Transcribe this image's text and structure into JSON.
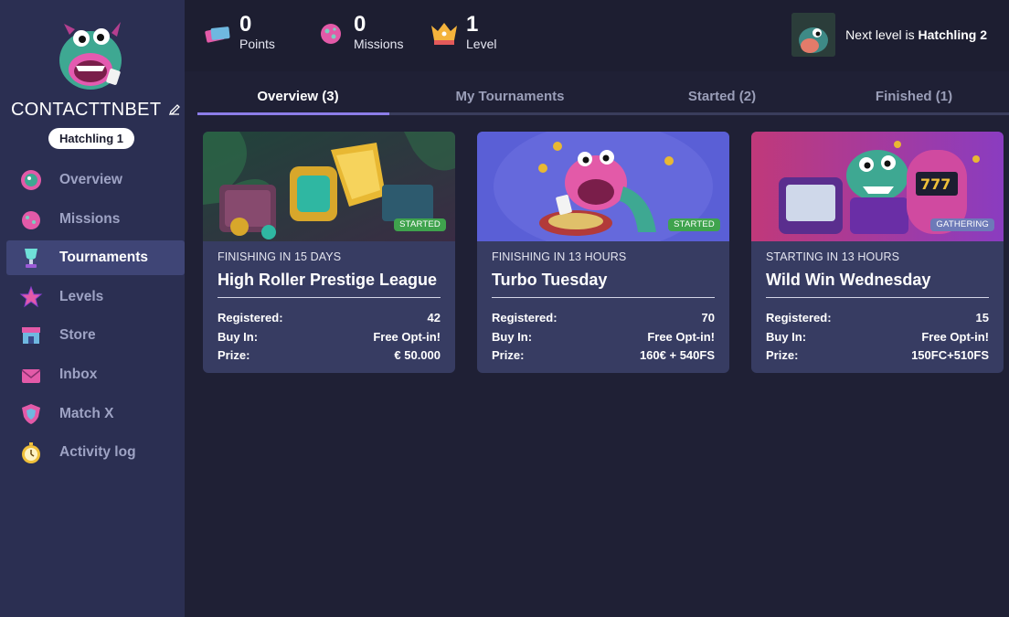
{
  "sidebar": {
    "username": "CONTACTTNBET",
    "level_badge": "Hatchling 1",
    "items": [
      {
        "label": "Overview",
        "icon": "dino-badge-icon",
        "active": false
      },
      {
        "label": "Missions",
        "icon": "egg-icon",
        "active": false
      },
      {
        "label": "Tournaments",
        "icon": "trophy-icon",
        "active": true
      },
      {
        "label": "Levels",
        "icon": "star-icon",
        "active": false
      },
      {
        "label": "Store",
        "icon": "store-icon",
        "active": false
      },
      {
        "label": "Inbox",
        "icon": "envelope-icon",
        "active": false
      },
      {
        "label": "Match X",
        "icon": "shield-icon",
        "active": false
      },
      {
        "label": "Activity log",
        "icon": "stopwatch-icon",
        "active": false
      }
    ]
  },
  "stats": {
    "points": {
      "value": "0",
      "label": "Points",
      "icon": "tickets-icon"
    },
    "missions": {
      "value": "0",
      "label": "Missions",
      "icon": "egg-icon"
    },
    "level": {
      "value": "1",
      "label": "Level",
      "icon": "crown-icon"
    }
  },
  "next_level": {
    "prefix": "Next level is",
    "name": "Hatchling 2"
  },
  "tabs": [
    {
      "label": "Overview (3)",
      "active": true
    },
    {
      "label": "My Tournaments",
      "active": false
    },
    {
      "label": "Started (2)",
      "active": false
    },
    {
      "label": "Finished (1)",
      "active": false
    }
  ],
  "cards": [
    {
      "status": "STARTED",
      "status_color": "#3fa34d",
      "when": "FINISHING IN 15 DAYS",
      "title": "High Roller Prestige League",
      "registered_label": "Registered:",
      "registered": "42",
      "buyin_label": "Buy In:",
      "buyin": "Free Opt-in!",
      "prize_label": "Prize:",
      "prize": "€ 50.000"
    },
    {
      "status": "STARTED",
      "status_color": "#3fa34d",
      "when": "FINISHING IN 13 HOURS",
      "title": "Turbo Tuesday",
      "registered_label": "Registered:",
      "registered": "70",
      "buyin_label": "Buy In:",
      "buyin": "Free Opt-in!",
      "prize_label": "Prize:",
      "prize": "160€ + 540FS"
    },
    {
      "status": "GATHERING",
      "status_color": "#6d7ab8",
      "when": "STARTING IN 13 HOURS",
      "title": "Wild Win Wednesday",
      "registered_label": "Registered:",
      "registered": "15",
      "buyin_label": "Buy In:",
      "buyin": "Free Opt-in!",
      "prize_label": "Prize:",
      "prize": "150FC+510FS"
    }
  ]
}
